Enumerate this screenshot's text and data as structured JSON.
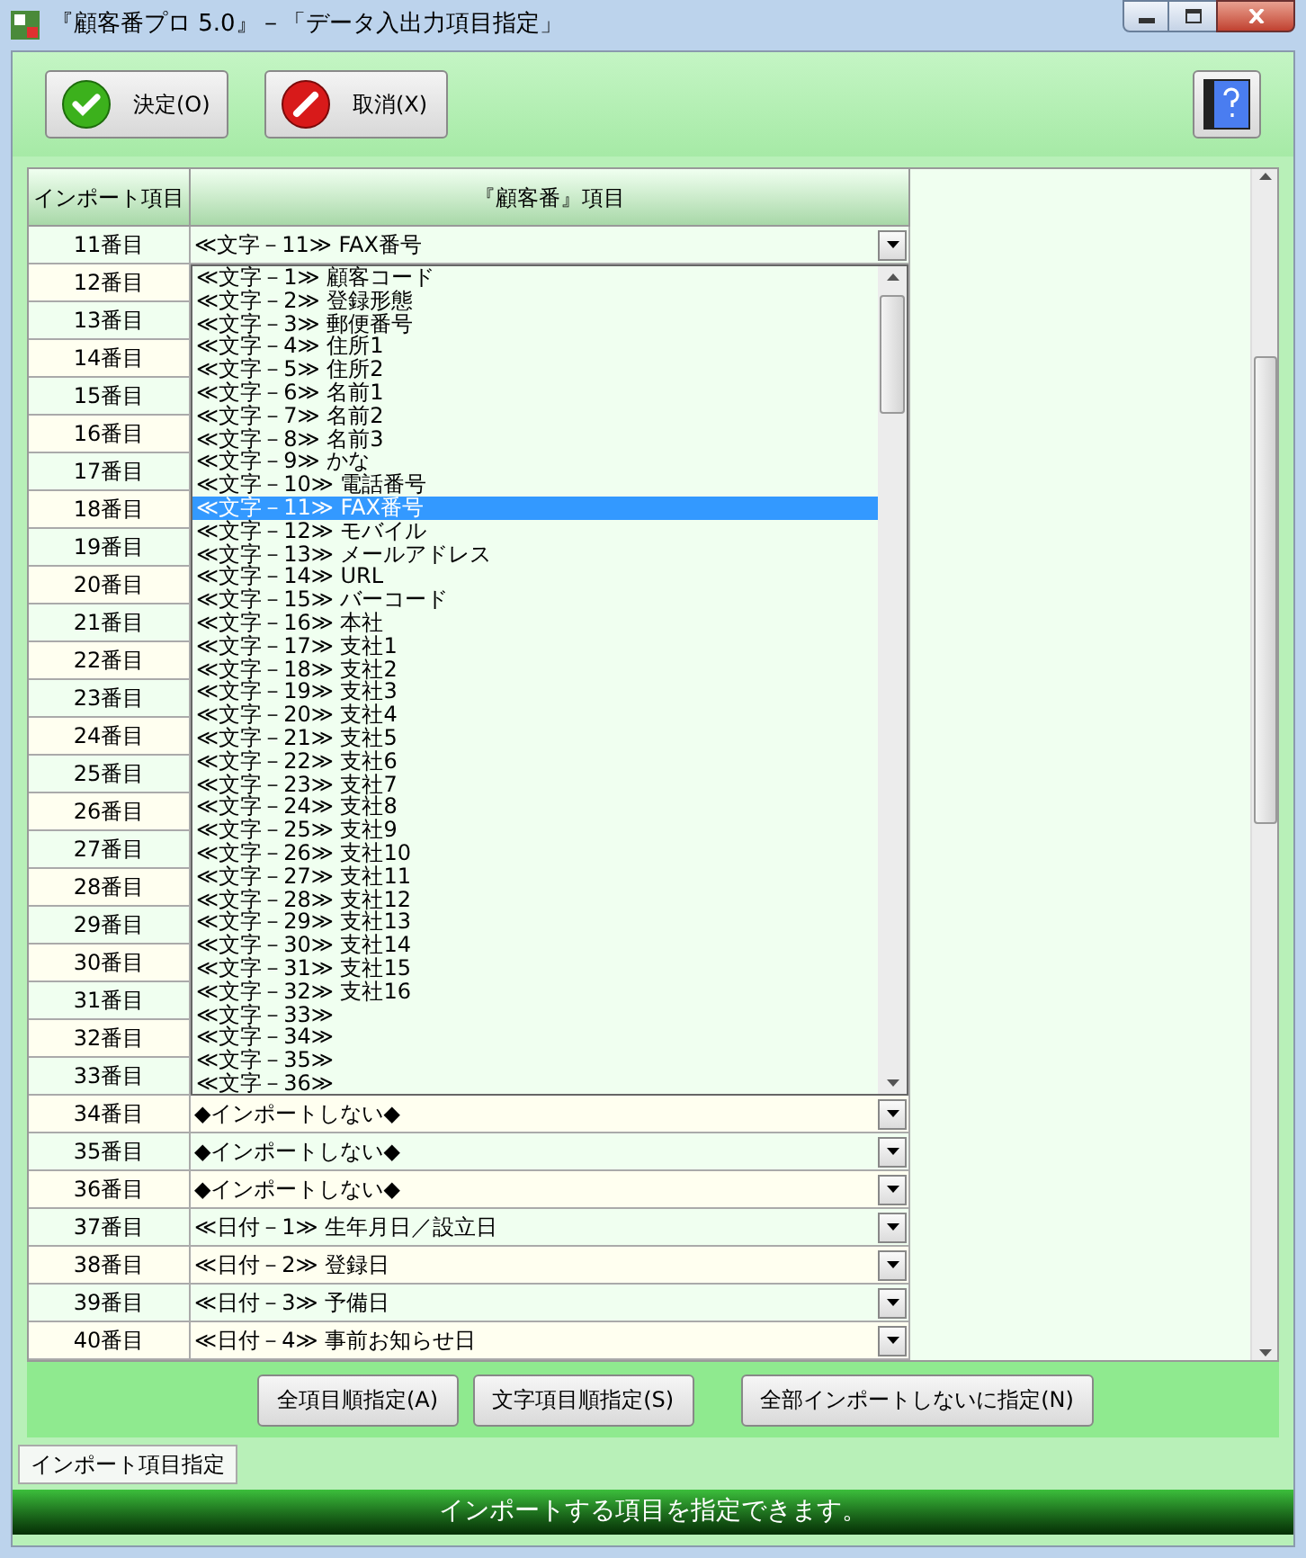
{
  "window": {
    "title": "『顧客番プロ 5.0』－「データ入出力項目指定」"
  },
  "toolbar": {
    "buttons": [
      {
        "label": "決定(O)",
        "kind": "ok"
      },
      {
        "label": "取消(X)",
        "kind": "cancel"
      }
    ]
  },
  "table": {
    "columns": [
      "インポート項目",
      "『顧客番』項目"
    ],
    "rows": [
      {
        "label": "11番目",
        "value": "≪文字－11≫ FAX番号"
      },
      {
        "label": "12番目"
      },
      {
        "label": "13番目"
      },
      {
        "label": "14番目"
      },
      {
        "label": "15番目"
      },
      {
        "label": "16番目"
      },
      {
        "label": "17番目"
      },
      {
        "label": "18番目"
      },
      {
        "label": "19番目"
      },
      {
        "label": "20番目"
      },
      {
        "label": "21番目"
      },
      {
        "label": "22番目"
      },
      {
        "label": "23番目"
      },
      {
        "label": "24番目"
      },
      {
        "label": "25番目"
      },
      {
        "label": "26番目"
      },
      {
        "label": "27番目"
      },
      {
        "label": "28番目"
      },
      {
        "label": "29番目"
      },
      {
        "label": "30番目"
      },
      {
        "label": "31番目"
      },
      {
        "label": "32番目"
      },
      {
        "label": "33番目"
      },
      {
        "label": "34番目",
        "value": "◆インポートしない◆"
      },
      {
        "label": "35番目",
        "value": "◆インポートしない◆"
      },
      {
        "label": "36番目",
        "value": "◆インポートしない◆"
      },
      {
        "label": "37番目",
        "value": "≪日付－1≫ 生年月日／設立日"
      },
      {
        "label": "38番目",
        "value": "≪日付－2≫ 登録日"
      },
      {
        "label": "39番目",
        "value": "≪日付－3≫ 予備日"
      },
      {
        "label": "40番目",
        "value": "≪日付－4≫ 事前お知らせ日"
      }
    ]
  },
  "dropdown": {
    "items": [
      {
        "text": "≪文字－1≫ 顧客コード",
        "selected": false
      },
      {
        "text": "≪文字－2≫ 登録形態",
        "selected": false
      },
      {
        "text": "≪文字－3≫ 郵便番号",
        "selected": false
      },
      {
        "text": "≪文字－4≫ 住所1",
        "selected": false
      },
      {
        "text": "≪文字－5≫ 住所2",
        "selected": false
      },
      {
        "text": "≪文字－6≫ 名前1",
        "selected": false
      },
      {
        "text": "≪文字－7≫ 名前2",
        "selected": false
      },
      {
        "text": "≪文字－8≫ 名前3",
        "selected": false
      },
      {
        "text": "≪文字－9≫ かな",
        "selected": false
      },
      {
        "text": "≪文字－10≫ 電話番号",
        "selected": false
      },
      {
        "text": "≪文字－11≫ FAX番号",
        "selected": true
      },
      {
        "text": "≪文字－12≫ モバイル",
        "selected": false
      },
      {
        "text": "≪文字－13≫ メールアドレス",
        "selected": false
      },
      {
        "text": "≪文字－14≫ URL",
        "selected": false
      },
      {
        "text": "≪文字－15≫ バーコード",
        "selected": false
      },
      {
        "text": "≪文字－16≫ 本社",
        "selected": false
      },
      {
        "text": "≪文字－17≫ 支社1",
        "selected": false
      },
      {
        "text": "≪文字－18≫ 支社2",
        "selected": false
      },
      {
        "text": "≪文字－19≫ 支社3",
        "selected": false
      },
      {
        "text": "≪文字－20≫ 支社4",
        "selected": false
      },
      {
        "text": "≪文字－21≫ 支社5",
        "selected": false
      },
      {
        "text": "≪文字－22≫ 支社6",
        "selected": false
      },
      {
        "text": "≪文字－23≫ 支社7",
        "selected": false
      },
      {
        "text": "≪文字－24≫ 支社8",
        "selected": false
      },
      {
        "text": "≪文字－25≫ 支社9",
        "selected": false
      },
      {
        "text": "≪文字－26≫ 支社10",
        "selected": false
      },
      {
        "text": "≪文字－27≫ 支社11",
        "selected": false
      },
      {
        "text": "≪文字－28≫ 支社12",
        "selected": false
      },
      {
        "text": "≪文字－29≫ 支社13",
        "selected": false
      },
      {
        "text": "≪文字－30≫ 支社14",
        "selected": false
      },
      {
        "text": "≪文字－31≫ 支社15",
        "selected": false
      },
      {
        "text": "≪文字－32≫ 支社16",
        "selected": false
      },
      {
        "text": "≪文字－33≫",
        "selected": false
      },
      {
        "text": "≪文字－34≫",
        "selected": false
      },
      {
        "text": "≪文字－35≫",
        "selected": false
      },
      {
        "text": "≪文字－36≫",
        "selected": false
      }
    ]
  },
  "actions": [
    "全項目順指定(A)",
    "文字項目順指定(S)",
    "全部インポートしないに指定(N)"
  ],
  "tabs": [
    {
      "label": "インポート項目指定",
      "selected": true
    }
  ],
  "status_bar": "インポートする項目を指定できます。"
}
